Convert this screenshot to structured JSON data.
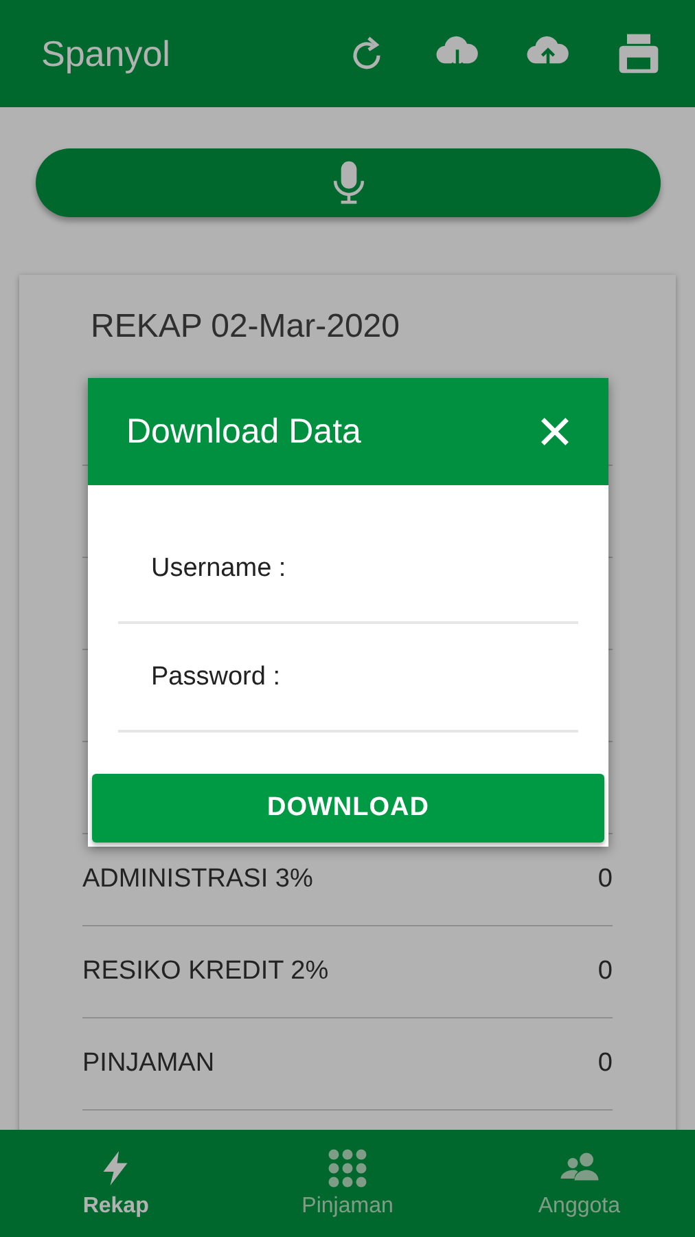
{
  "app_bar": {
    "title": "Spanyol"
  },
  "rekap": {
    "title": "REKAP 02-Mar-2020",
    "rows": [
      {
        "label": "ADMINISTRASI 3%",
        "value": "0"
      },
      {
        "label": "RESIKO KREDIT 2%",
        "value": "0"
      },
      {
        "label": "PINJAMAN",
        "value": "0"
      }
    ]
  },
  "dialog": {
    "title": "Download Data",
    "fields": [
      {
        "label": "Username :"
      },
      {
        "label": "Password :"
      }
    ],
    "button": "DOWNLOAD"
  },
  "bottom_nav": [
    {
      "label": "Rekap",
      "selected": true
    },
    {
      "label": "Pinjaman",
      "selected": false
    },
    {
      "label": "Anggota",
      "selected": false
    }
  ]
}
